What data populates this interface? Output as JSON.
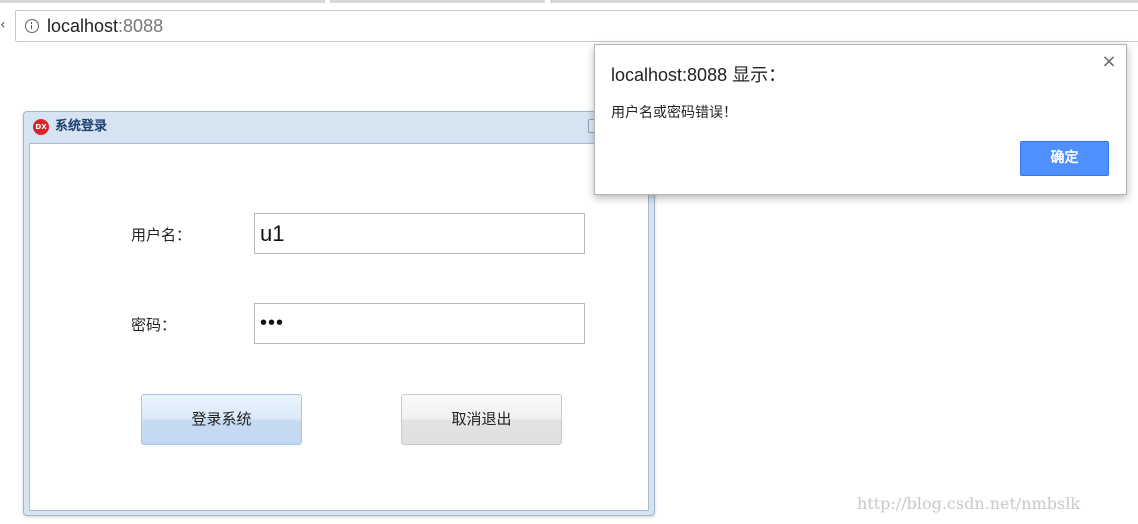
{
  "browser": {
    "url_host": "localhost",
    "url_port": ":8088",
    "nav_fragment": "‹"
  },
  "login_window": {
    "logo_text": "DX",
    "title": "系统登录",
    "username_label": "用户名：",
    "username_value": "u1",
    "password_label": "密码：",
    "password_value": "•••",
    "login_button": "登录系统",
    "cancel_button": "取消退出"
  },
  "alert": {
    "title": "localhost:8088 显示：",
    "message": "用户名或密码错误！",
    "close_glyph": "×",
    "ok_button": "确定"
  },
  "watermark": "http://blog.csdn.net/nmbslk",
  "colors": {
    "ok_button_bg": "#4d90fe",
    "window_frame": "#d6e3f1",
    "logo_red": "#d9242c"
  }
}
